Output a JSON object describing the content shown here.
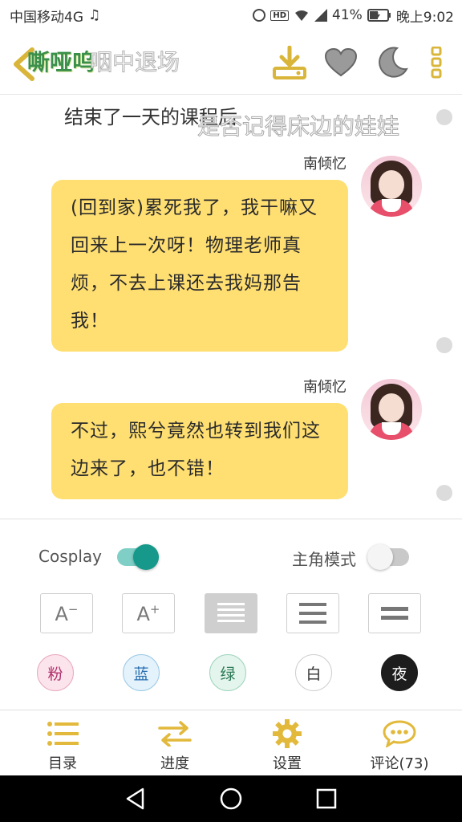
{
  "status_bar": {
    "carrier": "中国移动4G",
    "hd": "HD",
    "battery": "41%",
    "time": "晚上9:02"
  },
  "header": {
    "title_overlay": "嘶哑呜",
    "title_text": "咽中退场"
  },
  "content": {
    "narration_main": "结束了一天的课程后",
    "narration_overlay": "是否记得床边的娃娃",
    "messages": [
      {
        "speaker": "南倾忆",
        "text": "(回到家)累死我了，我干嘛又回来上一次呀！物理老师真烦，不去上课还去我妈那告我！"
      },
      {
        "speaker": "南倾忆",
        "text": "不过，熙兮竟然也转到我们这边来了，也不错！"
      }
    ]
  },
  "settings": {
    "cosplay_label": "Cosplay",
    "cosplay_on": true,
    "protagonist_label": "主角模式",
    "protagonist_on": false,
    "font_smaller": "A",
    "font_larger": "A",
    "spacing_options": [
      "dense",
      "medium",
      "loose"
    ],
    "selected_spacing": "dense",
    "themes": [
      {
        "label": "粉",
        "bg": "#fce4ec",
        "border": "#e9a8c0",
        "color": "#b0306a"
      },
      {
        "label": "蓝",
        "bg": "#e3f2fb",
        "border": "#9cc9e6",
        "color": "#2a6fb0"
      },
      {
        "label": "绿",
        "bg": "#e4f5ee",
        "border": "#9fd4bd",
        "color": "#2c7a55"
      },
      {
        "label": "白",
        "bg": "#ffffff",
        "border": "#cfcfcf",
        "color": "#333333"
      },
      {
        "label": "夜",
        "bg": "#1d1d1d",
        "border": "#1d1d1d",
        "color": "#ffffff"
      }
    ]
  },
  "bottom_nav": {
    "items": [
      {
        "label": "目录",
        "icon": "list-icon"
      },
      {
        "label": "进度",
        "icon": "swap-arrows-icon"
      },
      {
        "label": "设置",
        "icon": "gear-icon"
      },
      {
        "label": "评论(73)",
        "icon": "comment-icon"
      }
    ]
  },
  "colors": {
    "accent": "#e2b93b",
    "bubble": "#ffdf72",
    "toggle_on": "#16998a"
  }
}
